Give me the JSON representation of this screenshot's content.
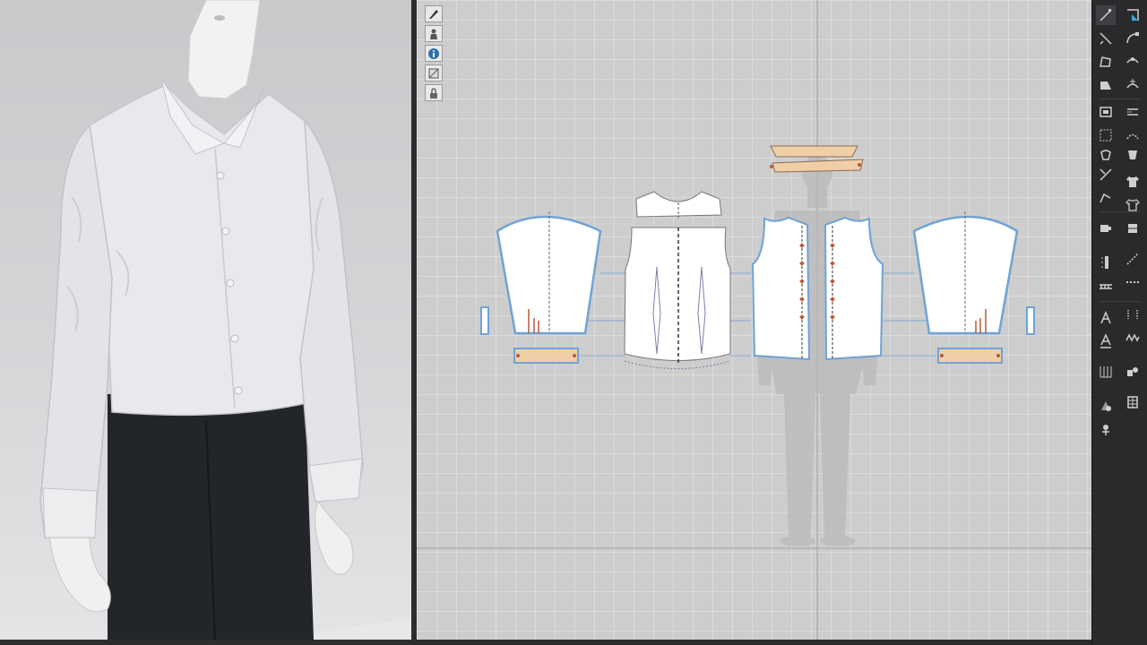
{
  "viewport3d": {
    "avatar": "male-avatar-wearing-shirt",
    "garment_color": "#e9e9ed",
    "pants_color": "#22262a"
  },
  "pattern_window": {
    "background_color": "#cdcdcd",
    "outline_color": "#6fa3d6",
    "accent_fill": "#f0cfa8",
    "pieces": [
      "collar",
      "collar-stand",
      "yoke",
      "back",
      "front-left",
      "front-right",
      "sleeve-left",
      "sleeve-right",
      "cuff-left",
      "cuff-right",
      "placket-left",
      "placket-right"
    ]
  },
  "pattern_toolbar": {
    "tools": [
      {
        "name": "select-icon"
      },
      {
        "name": "avatar-display-icon"
      },
      {
        "name": "info-icon"
      },
      {
        "name": "texture-icon"
      },
      {
        "name": "lock-icon"
      }
    ]
  },
  "right_toolbar": {
    "left_column": [
      "edit-pattern-icon",
      "transform-icon",
      "polygon-icon",
      "rectangle-icon",
      "internal-polygon-icon",
      "dart-icon",
      "trace-icon",
      "cut-icon",
      "segment-icon",
      "scissors-icon",
      "measure-icon",
      "ruler-icon",
      "text-icon",
      "annotation-icon",
      "grid-icon",
      "fold-icon",
      "pin-icon"
    ],
    "right_column": [
      "point-icon",
      "curve-icon",
      "curve-point-icon",
      "add-point-icon",
      "offset-icon",
      "seam-icon",
      "pleat-icon",
      "shirt-icon",
      "shirt-fit-icon",
      "fold-arrange-icon",
      "topstitch-icon",
      "line-icon",
      "width-icon",
      "stitch-icon",
      "zigzag-icon",
      "bind-icon",
      "button-icon",
      "buttonhole-icon"
    ]
  }
}
